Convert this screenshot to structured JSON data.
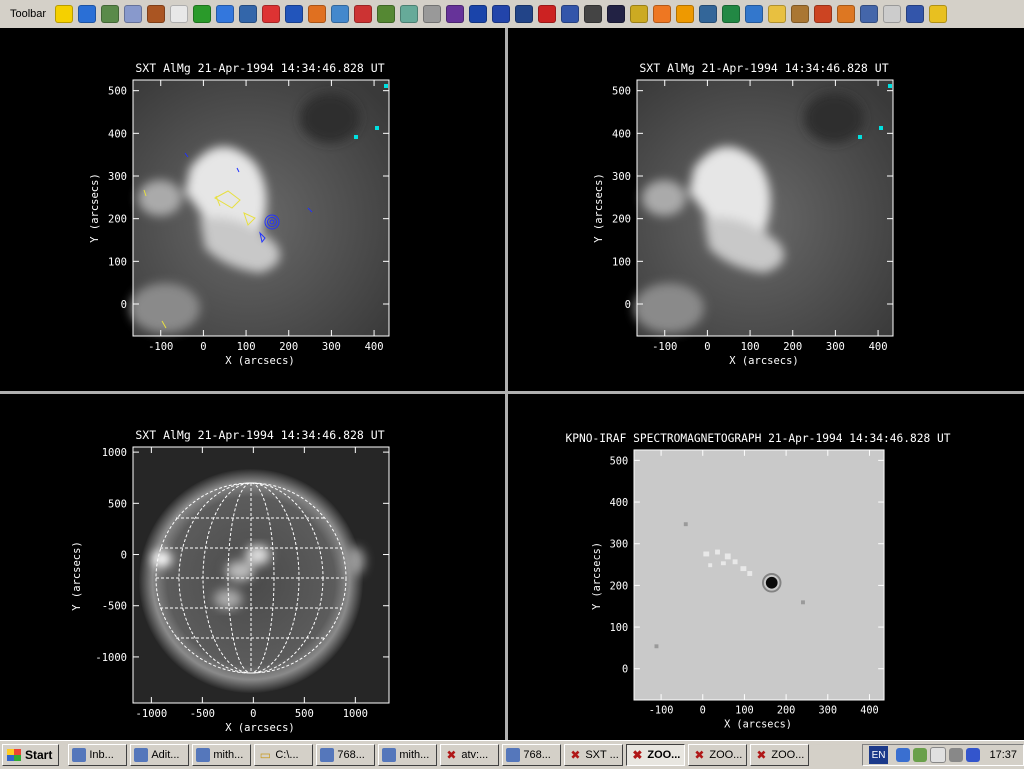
{
  "toolbar": {
    "label": "Toolbar",
    "buttons": [
      {
        "icon": "app-a-icon",
        "color": "#f5d000"
      },
      {
        "icon": "globe-icon",
        "color": "#2a6fd6"
      },
      {
        "icon": "landscape-icon",
        "color": "#5a8a4a"
      },
      {
        "icon": "document-icon",
        "color": "#8899cc"
      },
      {
        "icon": "owl-icon",
        "color": "#aa5522"
      },
      {
        "icon": "chat-bubble-icon",
        "color": "#e8e8e8"
      },
      {
        "icon": "clover-icon",
        "color": "#2a9a2a"
      },
      {
        "icon": "browser-e-icon",
        "color": "#3377dd"
      },
      {
        "icon": "mail-icon",
        "color": "#3366aa"
      },
      {
        "icon": "lifebuoy-icon",
        "color": "#dd3333"
      },
      {
        "icon": "word-icon",
        "color": "#2255bb"
      },
      {
        "icon": "firefox-icon",
        "color": "#e07020"
      },
      {
        "icon": "person-icon",
        "color": "#4488cc"
      },
      {
        "icon": "disc-icon",
        "color": "#cc3333"
      },
      {
        "icon": "wheel-icon",
        "color": "#558833"
      },
      {
        "icon": "network-icon",
        "color": "#66aa99"
      },
      {
        "icon": "calendar-icon",
        "color": "#999999"
      },
      {
        "icon": "wand-icon",
        "color": "#663399"
      },
      {
        "icon": "grid-icon",
        "color": "#1a44aa"
      },
      {
        "icon": "window-icon",
        "color": "#2244aa"
      },
      {
        "icon": "ftp-icon",
        "color": "#224488"
      },
      {
        "icon": "red-dot-icon",
        "color": "#cc2222"
      },
      {
        "icon": "monitor-icon",
        "color": "#3355aa"
      },
      {
        "icon": "terminal-icon",
        "color": "#444444"
      },
      {
        "icon": "close-x-icon",
        "color": "#222244"
      },
      {
        "icon": "stamp-icon",
        "color": "#ccaa22"
      },
      {
        "icon": "at-sign-icon",
        "color": "#ee7722"
      },
      {
        "icon": "sun-icon",
        "color": "#ee9900"
      },
      {
        "icon": "search-globe-icon",
        "color": "#336699"
      },
      {
        "icon": "spreadsheet-icon",
        "color": "#228844"
      },
      {
        "icon": "target-icon",
        "color": "#3377cc"
      },
      {
        "icon": "folder-icon",
        "color": "#e8c040"
      },
      {
        "icon": "cup-icon",
        "color": "#aa7733"
      },
      {
        "icon": "photo-icon",
        "color": "#cc4422"
      },
      {
        "icon": "clock-icon",
        "color": "#dd7722"
      },
      {
        "icon": "images-icon",
        "color": "#4466aa"
      },
      {
        "icon": "cd-icon",
        "color": "#cccccc"
      },
      {
        "icon": "desktop-icon",
        "color": "#3355aa"
      },
      {
        "icon": "warning-icon",
        "color": "#e8c020"
      }
    ]
  },
  "panels": {
    "top_left": {
      "title": "SXT AlMg 21-Apr-1994 14:34:46.828 UT",
      "xlabel": "X (arcsecs)",
      "ylabel": "Y (arcsecs)"
    },
    "top_right": {
      "title": "SXT AlMg 21-Apr-1994 14:34:46.828 UT",
      "xlabel": "X (arcsecs)",
      "ylabel": "Y (arcsecs)"
    },
    "bottom_left": {
      "title": "SXT AlMg 21-Apr-1994 14:34:46.828 UT",
      "xlabel": "X (arcsecs)",
      "ylabel": "Y (arcsecs)"
    },
    "bottom_right": {
      "title": "KPNO-IRAF SPECTROMAGNETOGRAPH 21-Apr-1994 14:34:46.828 UT",
      "xlabel": "X (arcsecs)",
      "ylabel": "Y (arcsecs)"
    }
  },
  "axes": {
    "zoom": {
      "x_ticks": [
        "-100",
        "0",
        "100",
        "200",
        "300",
        "400"
      ],
      "y_ticks": [
        "0",
        "100",
        "200",
        "300",
        "400",
        "500"
      ]
    },
    "full": {
      "x_ticks": [
        "-1000",
        "-500",
        "0",
        "500",
        "1000"
      ],
      "y_ticks": [
        "-1000",
        "-500",
        "0",
        "500",
        "1000"
      ]
    }
  },
  "taskbar": {
    "start_label": "Start",
    "tasks": [
      {
        "label": "Inb...",
        "icon": "mail-icon",
        "active": false
      },
      {
        "label": "Adit...",
        "icon": "app-a-icon",
        "active": false
      },
      {
        "label": "mith...",
        "icon": "monitor-icon",
        "active": false
      },
      {
        "label": "C:\\...",
        "icon": "folder-icon",
        "active": false
      },
      {
        "label": "768...",
        "icon": "landscape-icon",
        "active": false
      },
      {
        "label": "mith...",
        "icon": "monitor-icon",
        "active": false
      },
      {
        "label": "atv:...",
        "icon": "close-x-icon",
        "active": false
      },
      {
        "label": "768...",
        "icon": "cup-icon",
        "active": false
      },
      {
        "label": "SXT ...",
        "icon": "close-x-icon",
        "active": false
      },
      {
        "label": "ZOO...",
        "icon": "close-x-icon",
        "active": true
      },
      {
        "label": "ZOO...",
        "icon": "close-x-icon",
        "active": false
      },
      {
        "label": "ZOO...",
        "icon": "close-x-icon",
        "active": false
      }
    ],
    "language": "EN",
    "clock": "17:37"
  }
}
